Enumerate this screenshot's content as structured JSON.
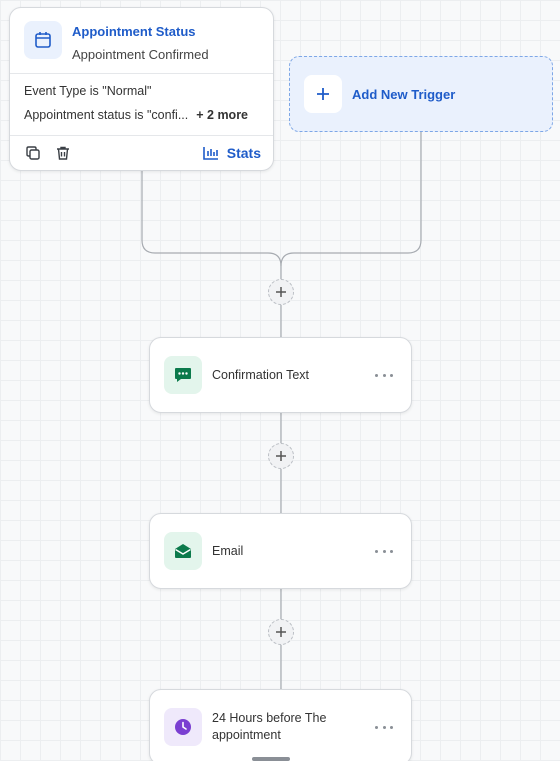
{
  "trigger": {
    "title": "Appointment Status",
    "subtitle": "Appointment Confirmed",
    "filters": [
      "Event Type is \"Normal\"",
      "Appointment status is \"confi..."
    ],
    "more": "+ 2 more",
    "icons": {
      "main": "calendar-icon",
      "copy": "copy-icon",
      "delete": "trash-icon",
      "stats": "bar-chart-icon"
    },
    "stats_label": "Stats"
  },
  "add_trigger": {
    "label": "Add New Trigger",
    "icon": "plus-icon"
  },
  "actions": [
    {
      "label": "Confirmation Text",
      "icon": "sms-chat-icon"
    },
    {
      "label": "Email",
      "icon": "envelope-open-icon"
    },
    {
      "label": "24 Hours before The appointment",
      "icon": "clock-icon"
    }
  ],
  "colors": {
    "accent": "#1f5cc9",
    "trigger_bg": "#eaf1fd",
    "sms_green": "#0c7a4c",
    "email_green": "#0c7a4c",
    "wait_purple": "#7a3fd1"
  }
}
